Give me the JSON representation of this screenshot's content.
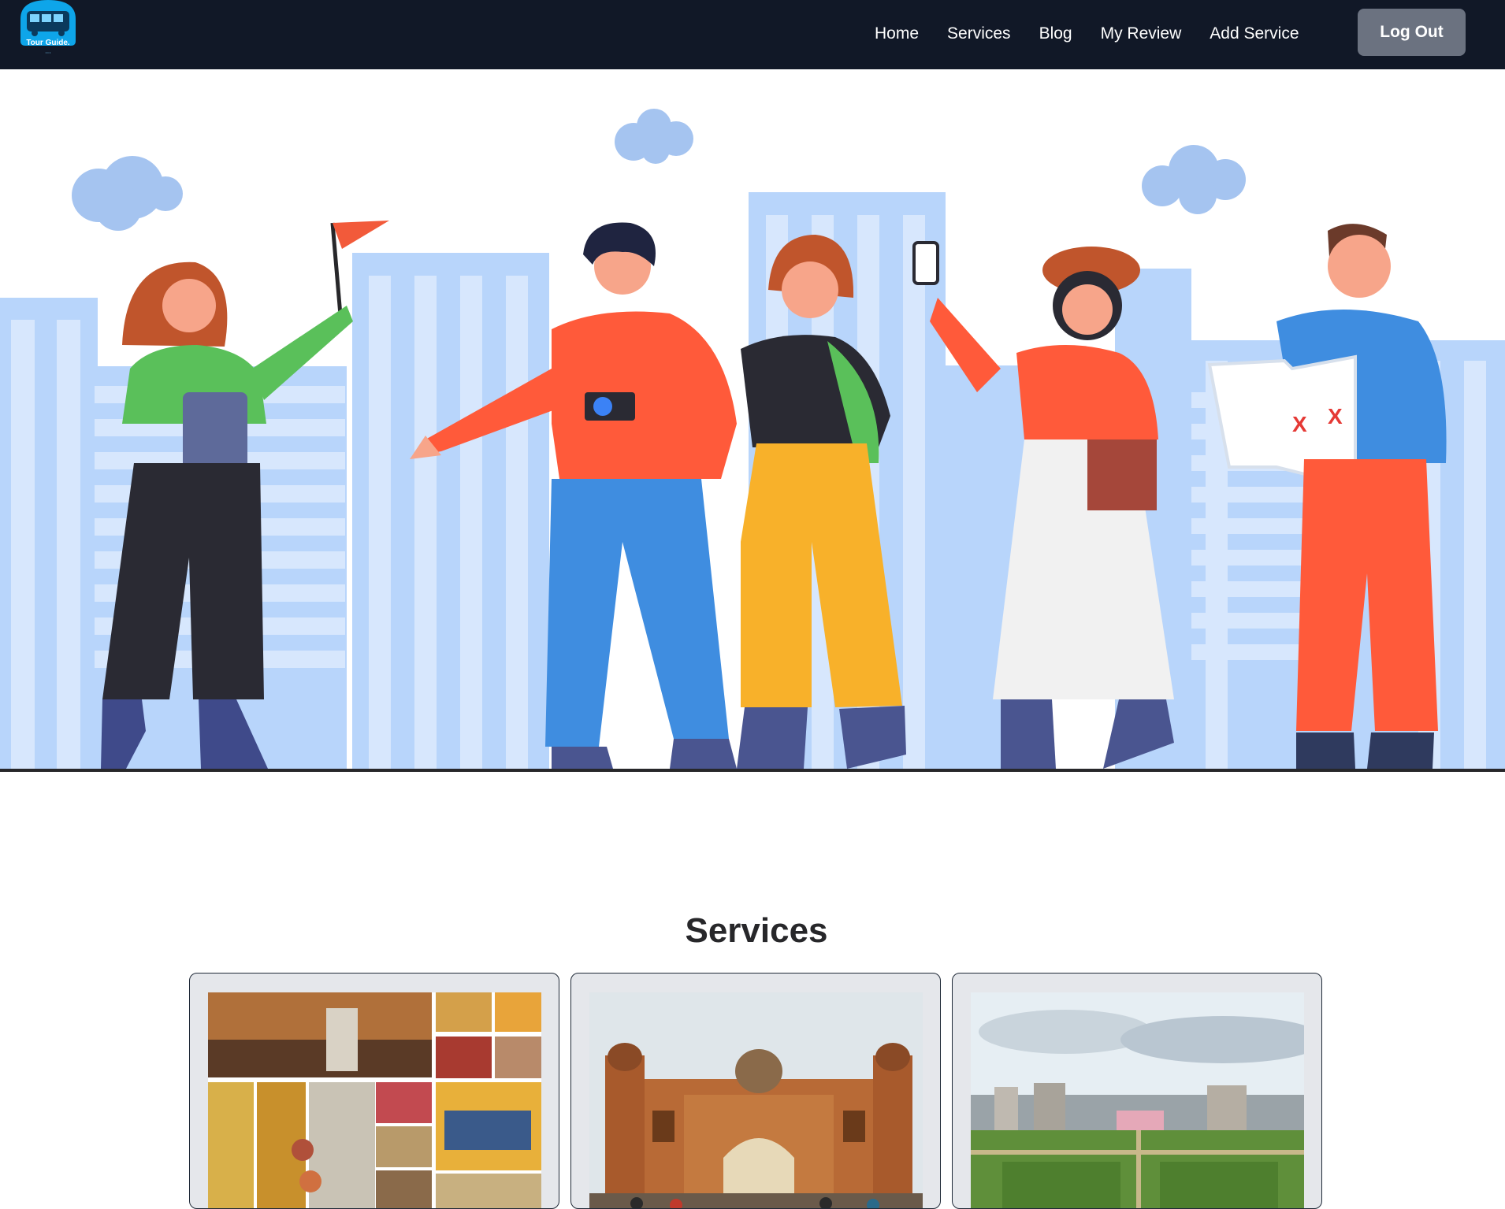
{
  "brand": {
    "logo_text": "Tour Guide."
  },
  "nav": {
    "links": [
      "Home",
      "Services",
      "Blog",
      "My Review",
      "Add Service"
    ],
    "logout_label": "Log Out"
  },
  "services": {
    "title": "Services",
    "cards": [
      {
        "image": "bangladesh-culture-collage-photo"
      },
      {
        "image": "lalbagh-fort-mughal-gate-photo"
      },
      {
        "image": "lalbagh-fort-gardens-city-photo"
      }
    ]
  },
  "colors": {
    "navbar_bg": "#111827",
    "logout_bg": "#6b7280",
    "logo_blue": "#0ea5e9",
    "hero_sky_blue": "#a9c8f2",
    "card_bg": "#e5e7eb"
  }
}
